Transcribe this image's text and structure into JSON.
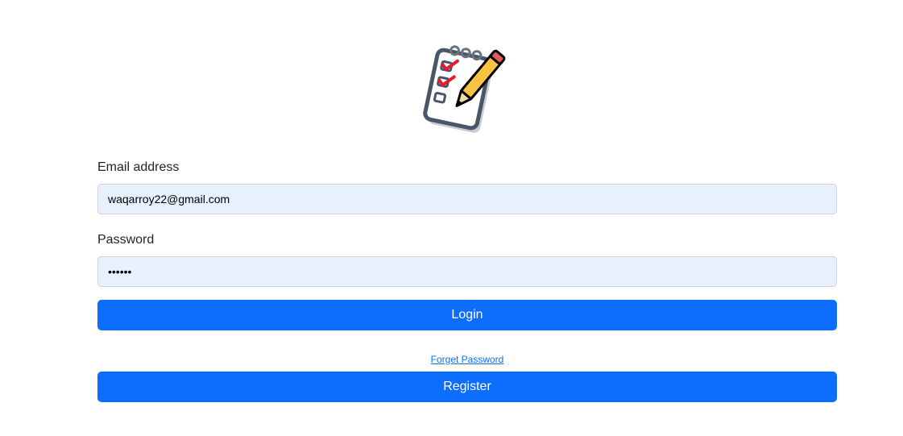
{
  "logo": {
    "icon": "notepad-checklist-pencil-icon"
  },
  "form": {
    "email_label": "Email address",
    "email_value": "waqarroy22@gmail.com",
    "password_label": "Password",
    "password_value": "••••••",
    "login_label": "Login",
    "forget_password_label": "Forget Password",
    "register_label": "Register"
  },
  "colors": {
    "primary": "#0d6efd",
    "input_background": "#e8f0fe",
    "text": "#212529"
  }
}
